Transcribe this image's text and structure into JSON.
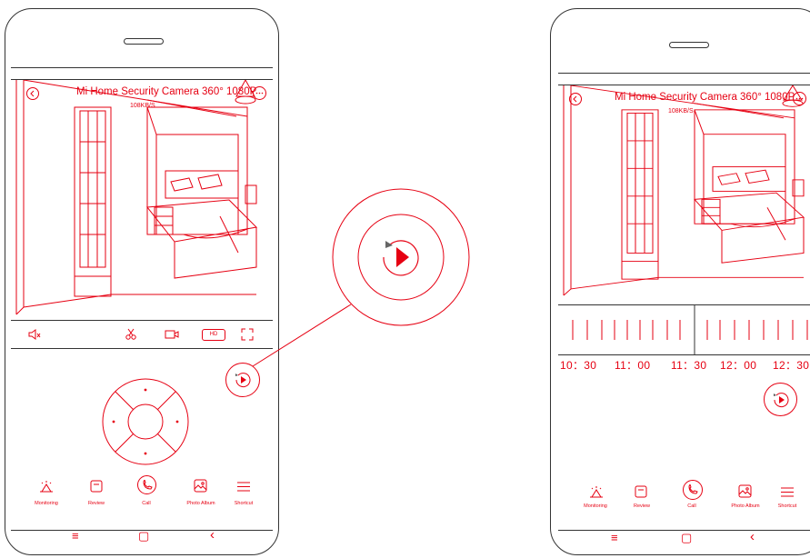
{
  "colors": {
    "accent": "#e60012",
    "outline": "#333333"
  },
  "left_phone": {
    "title": "Mi Home Security Camera 360° 1080P",
    "speed": "108KB/S",
    "controls": {
      "mute_icon": "mute-icon",
      "screenshot_icon": "screenshot-icon",
      "record_icon": "video-record-icon",
      "quality_label": "HD",
      "fullscreen_icon": "fullscreen-icon"
    },
    "nav": [
      {
        "label": "Monitoring",
        "icon": "alarm-icon"
      },
      {
        "label": "Review",
        "icon": "review-icon"
      },
      {
        "label": "Call",
        "icon": "phone-icon"
      },
      {
        "label": "Photo Album",
        "icon": "photo-album-icon"
      },
      {
        "label": "Shortcut",
        "icon": "menu-icon"
      }
    ],
    "system_nav": {
      "menu": "≡",
      "home": "▢",
      "back": "‹"
    }
  },
  "right_phone": {
    "title": "Mi Home Security Camera 360° 1080P",
    "speed": "108KB/S",
    "timeline": [
      "10：30",
      "11：00",
      "11：30",
      "12：00",
      "12：30"
    ],
    "nav": [
      {
        "label": "Monitoring",
        "icon": "alarm-icon"
      },
      {
        "label": "Review",
        "icon": "review-icon"
      },
      {
        "label": "Call",
        "icon": "phone-icon"
      },
      {
        "label": "Photo Album",
        "icon": "photo-album-icon"
      },
      {
        "label": "Shortcut",
        "icon": "menu-icon"
      }
    ],
    "system_nav": {
      "menu": "≡",
      "home": "▢",
      "back": "‹"
    }
  },
  "callout": {
    "icon": "replay-play-icon"
  }
}
